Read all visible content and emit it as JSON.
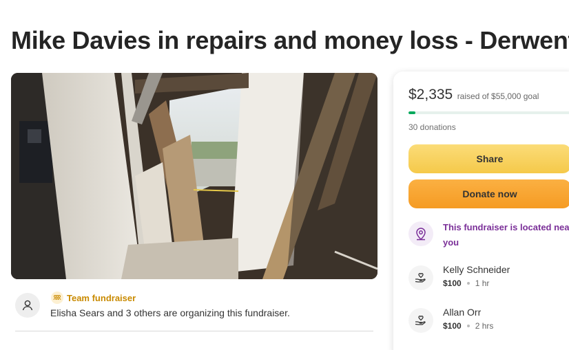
{
  "page": {
    "title": "Mike Davies in repairs and money loss - Derwent"
  },
  "hero_image": {
    "description_icon": "damaged-building-photo"
  },
  "organizer": {
    "team_label": "Team fundraiser",
    "text": "Elisha Sears and 3 others are organizing this fundraiser.",
    "avatar_icon": "user-icon",
    "team_icon": "team-icon"
  },
  "card": {
    "amount": "$2,335",
    "goal_text": "raised of $55,000 goal",
    "progress_fraction": 0.042,
    "donations": "30 donations",
    "share_label": "Share",
    "donate_label": "Donate now",
    "near_text": "This fundraiser is located near you",
    "near_icon": "location-pin-icon",
    "donors": [
      {
        "name": "Kelly Schneider",
        "amount": "$100",
        "time": "1 hr"
      },
      {
        "name": "Allan Orr",
        "amount": "$100",
        "time": "2 hrs"
      }
    ]
  },
  "colors": {
    "progress": "#02a95c",
    "share_button": "#f8d35e",
    "donate_button": "#f7a530",
    "near_text": "#7a2f98",
    "team_label": "#c98a00"
  }
}
